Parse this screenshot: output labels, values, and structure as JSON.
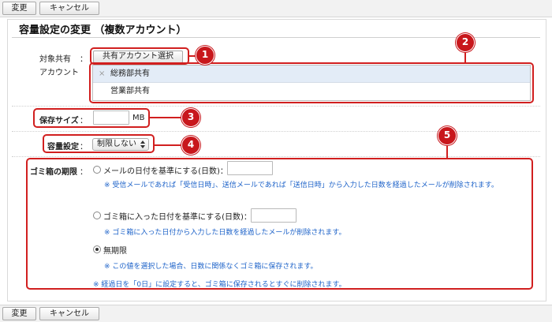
{
  "toolbar": {
    "change_label": "変更",
    "cancel_label": "キャンセル"
  },
  "page": {
    "title": "容量設定の変更 （複数アカウント）"
  },
  "shared": {
    "label_line1": "対象共有",
    "colon": "：",
    "label_line2": "アカウント",
    "select_button": "共有アカウント選択",
    "accounts": [
      {
        "name": "総務部共有",
        "remove_icon": "×"
      },
      {
        "name": "営業部共有"
      }
    ]
  },
  "storage": {
    "label": "保存サイズ",
    "colon": "：",
    "value": "",
    "unit": "MB"
  },
  "capacity": {
    "label": "容量設定",
    "colon": "：",
    "selected": "制限しない"
  },
  "trash": {
    "label": "ゴミ箱の期限",
    "colon": "：",
    "options": [
      {
        "label": "メールの日付を基準にする(日数)：",
        "value": "",
        "note": "※ 受信メールであれば「受信日時」、送信メールであれば「送信日時」から入力した日数を経過したメールが削除されます。",
        "checked": false
      },
      {
        "label": "ゴミ箱に入った日付を基準にする(日数)：",
        "value": "",
        "note": "※ ゴミ箱に入った日付から入力した日数を経過したメールが削除されます。",
        "checked": false
      },
      {
        "label": "無期限",
        "note": "※ この値を選択した場合、日数に関係なくゴミ箱に保存されます。",
        "checked": true
      }
    ],
    "footer_note": "※ 経過日を「0日」に設定すると、ゴミ箱に保存されるとすぐに削除されます。"
  },
  "callouts": [
    "1",
    "2",
    "3",
    "4",
    "5"
  ],
  "colors": {
    "callout": "#c8171c",
    "note": "#1e63c9",
    "selected_row": "#e3ecf7"
  }
}
